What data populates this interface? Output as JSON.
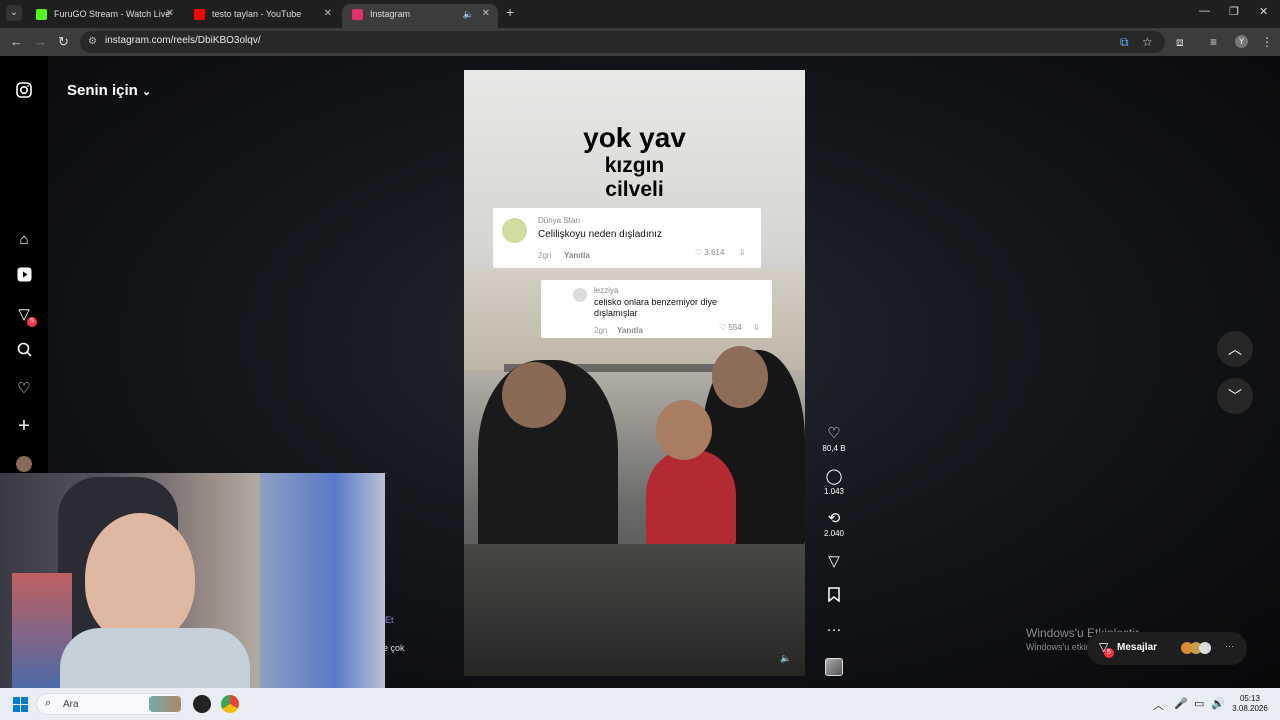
{
  "browser": {
    "tabs": [
      {
        "title": "FuruGO Stream - Watch Live on",
        "favicon_color": "#53fc18"
      },
      {
        "title": "testo taylan - YouTube",
        "favicon_color": "#ff0000"
      },
      {
        "title": "Instagram",
        "favicon_color": "#e1306c",
        "active": true
      }
    ],
    "new_tab": "+",
    "url": "instagram.com/reels/DbiKBO3olqv/",
    "profile_initial": "Y"
  },
  "instagram": {
    "feed_title": "Senin için",
    "notification_count": "5",
    "reel": {
      "overlay_lines": [
        "yok yav",
        "kızgın",
        "cilveli"
      ],
      "comment1": {
        "user": "Dünya Starı",
        "text": "Celilişkoyu neden dışladınız",
        "time": "2gn",
        "reply": "Yanıtla",
        "likes": "3.614"
      },
      "comment2": {
        "user": "lezziya",
        "text_line1": "celisko onlara benzemiyor diye",
        "text_line2": "dışlamışlar",
        "time": "2gn",
        "reply": "Yanıtla",
        "likes": "554"
      }
    },
    "actions": {
      "likes": "80,4 B",
      "comments": "1.043",
      "reposts": "2.040"
    },
    "messages": {
      "label": "Mesajlar",
      "badge": "5"
    },
    "under_text1": "Et",
    "under_text2": "e çok"
  },
  "windows_activation": {
    "line1": "Windows'u Etkinleştir",
    "line2": "Windows'u etkinleştirmek için Ayarlar'a gidin."
  },
  "taskbar": {
    "search_label": "Ara",
    "time": "05:13",
    "date": "3.08.2026"
  }
}
